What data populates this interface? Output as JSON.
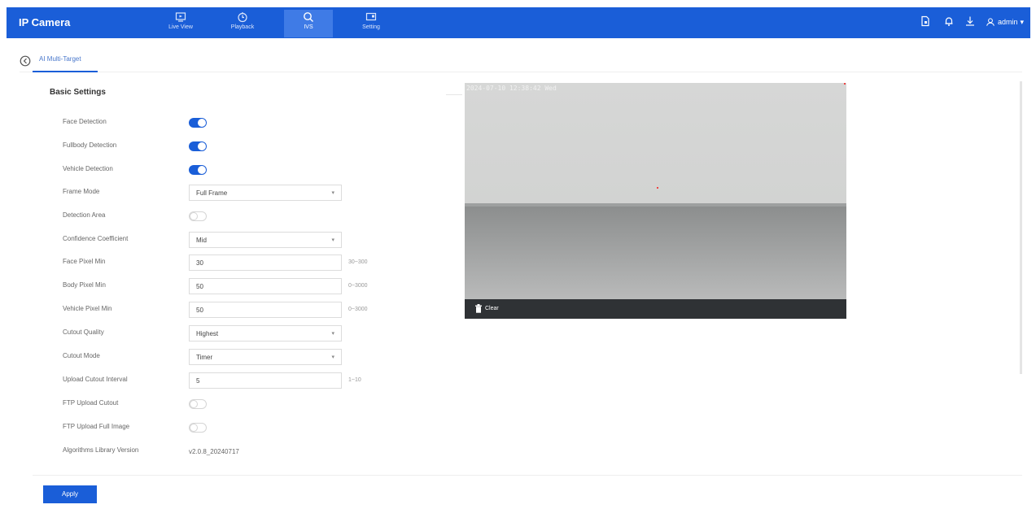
{
  "app": {
    "title": "IP Camera"
  },
  "nav": [
    {
      "label": "Live View",
      "icon": "monitor-icon"
    },
    {
      "label": "Playback",
      "icon": "clock-icon"
    },
    {
      "label": "IVS",
      "icon": "ai-search-icon"
    },
    {
      "label": "Setting",
      "icon": "settings-monitor-icon"
    }
  ],
  "toolbar": {
    "user": "admin"
  },
  "tab": {
    "label": "AI Multi-Target"
  },
  "section": {
    "title": "Basic Settings"
  },
  "form": {
    "face_detection": {
      "label": "Face Detection",
      "on": true
    },
    "fullbody_detection": {
      "label": "Fullbody Detection",
      "on": true
    },
    "vehicle_detection": {
      "label": "Vehicle Detection",
      "on": true
    },
    "frame_mode": {
      "label": "Frame Mode",
      "value": "Full Frame"
    },
    "detection_area": {
      "label": "Detection Area",
      "on": false
    },
    "confidence": {
      "label": "Confidence Coefficient",
      "value": "Mid"
    },
    "face_pixel_min": {
      "label": "Face Pixel Min",
      "value": "30",
      "range": "30~300"
    },
    "body_pixel_min": {
      "label": "Body Pixel Min",
      "value": "50",
      "range": "0~3000"
    },
    "vehicle_pixel_min": {
      "label": "Vehicle Pixel Min",
      "value": "50",
      "range": "0~3000"
    },
    "cutout_quality": {
      "label": "Cutout Quality",
      "value": "Highest"
    },
    "cutout_mode": {
      "label": "Cutout Mode",
      "value": "Timer"
    },
    "upload_interval": {
      "label": "Upload Cutout Interval",
      "value": "5",
      "range": "1~10"
    },
    "ftp_cutout": {
      "label": "FTP Upload Cutout",
      "on": false
    },
    "ftp_full_image": {
      "label": "FTP Upload Full Image",
      "on": false
    },
    "algo_version": {
      "label": "Algorithms Library Version",
      "value": "v2.0.8_20240717"
    }
  },
  "preview": {
    "osd": "2024-07-10 12:38:42 Wed",
    "clear_label": "Clear"
  },
  "footer": {
    "apply_label": "Apply"
  },
  "colors": {
    "primary": "#1a5ed8",
    "nav_active": "#3f7be6"
  }
}
